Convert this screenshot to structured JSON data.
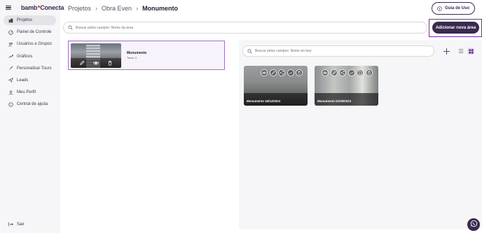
{
  "brand": {
    "name": "bamb",
    "name_suffix": "Conecta"
  },
  "sidebar": {
    "items": [
      {
        "label": "Projetos",
        "icon": "building-icon",
        "active": true
      },
      {
        "label": "Painel de Controle",
        "icon": "dashboard-icon",
        "active": false
      },
      {
        "label": "Usuários e Grupos",
        "icon": "users-icon",
        "active": false
      },
      {
        "label": "Gráficos",
        "icon": "trend-chart-icon",
        "active": false
      },
      {
        "label": "Personalizar Tours",
        "icon": "brush-icon",
        "active": false
      },
      {
        "label": "Leads",
        "icon": "send-icon",
        "active": false
      },
      {
        "label": "Meu Perfil",
        "icon": "user-icon",
        "active": false
      },
      {
        "label": "Central de ajuda",
        "icon": "help-icon",
        "active": false
      }
    ],
    "logout_label": "Sair"
  },
  "breadcrumb": {
    "root": "Projetos",
    "parent": "Obra Even",
    "current": "Monumento"
  },
  "header": {
    "guide_label": "Guia de Uso"
  },
  "search": {
    "areas_placeholder": "Buscar pelos campos: Nome da área",
    "tours_placeholder": "Buscar pelos campos: Nome do tour"
  },
  "actions": {
    "add_area_label": "Adicionar nova área"
  },
  "area": {
    "title": "Monumento",
    "subtitle": "Tours: 2"
  },
  "tours": [
    {
      "label": "Monumento 18/12/2024",
      "tools": [
        "eye-icon",
        "pencil-icon",
        "share-icon",
        "trend-icon",
        "trash-icon"
      ]
    },
    {
      "label": "Monumento 01/09/2023",
      "tools": [
        "eye-icon",
        "pencil-icon",
        "share-icon",
        "trend-icon",
        "document-icon",
        "trash-icon"
      ]
    }
  ],
  "colors": {
    "brand": "#3a2a4e",
    "accent_border": "#7a2a9a",
    "selected_border": "#a070c8"
  }
}
